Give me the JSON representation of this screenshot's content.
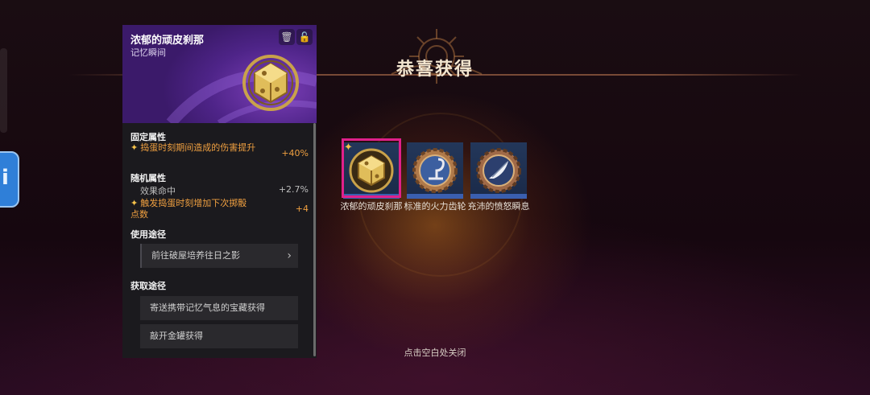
{
  "dialog": {
    "title": "恭喜获得",
    "close_hint": "点击空白处关闭"
  },
  "panel": {
    "item_name": "浓郁的顽皮刹那",
    "item_type": "记忆瞬间",
    "fixed_section": "固定属性",
    "fixed_attr": {
      "label": "捣蛋时刻期间造成的伤害提升",
      "value": "+40%"
    },
    "random_section": "随机属性",
    "random_attrs": [
      {
        "label": "效果命中",
        "value": "+2.7%"
      },
      {
        "label": "触发捣蛋时刻增加下次掷骰点数",
        "value": "+4"
      }
    ],
    "usage_section": "使用途径",
    "usage_link": "前往破屋培养往日之影",
    "obtain_section": "获取途径",
    "obtain_items": [
      "寄送携带记忆气息的宝藏获得",
      "敲开金罐获得"
    ]
  },
  "rewards": [
    {
      "label": "浓郁的顽皮刹那",
      "icon": "golden-cube-emblem-icon"
    },
    {
      "label": "标准的火力齿轮",
      "icon": "hook-gear-emblem-icon"
    },
    {
      "label": "充沛的愤怒瞬息",
      "icon": "feather-emblem-icon"
    }
  ],
  "colors": {
    "accent_orange": "#f0a040",
    "select_pink": "#e0208a",
    "panel_purple": "#4e2488"
  }
}
